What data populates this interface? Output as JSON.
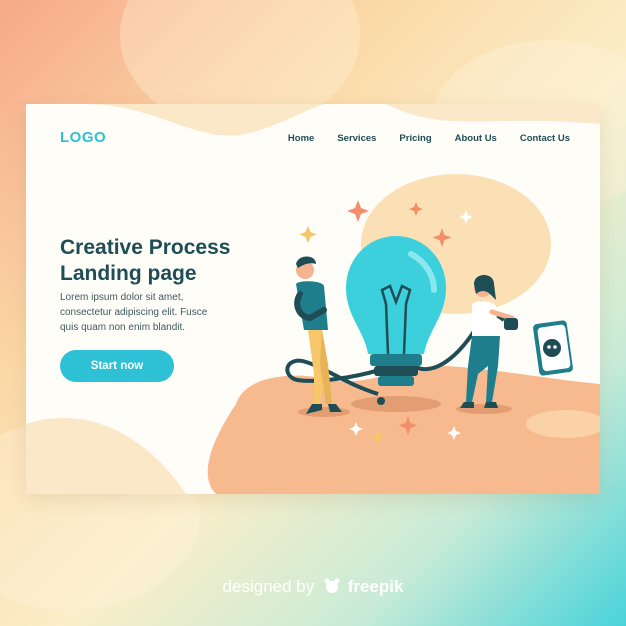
{
  "header": {
    "logo": "LOGO",
    "nav": [
      "Home",
      "Services",
      "Pricing",
      "About Us",
      "Contact Us"
    ]
  },
  "hero": {
    "title_line1": "Creative Process",
    "title_line2": "Landing page",
    "desc_line1": "Lorem ipsum dolor sit amet,",
    "desc_line2": "consectetur adipiscing elit. Fusce",
    "desc_line3": "quis quam non enim blandit.",
    "cta_label": "Start now"
  },
  "credit": {
    "prefix": "designed by",
    "brand": "freepik"
  },
  "colors": {
    "accent": "#2ec1d5",
    "dark_text": "#1f4d56",
    "peach": "#f7b98e",
    "cream": "#fbe5c4"
  },
  "icons": [
    "lightbulb-illustration",
    "sparkle-icon",
    "power-socket-icon",
    "freepik-logo-icon"
  ]
}
